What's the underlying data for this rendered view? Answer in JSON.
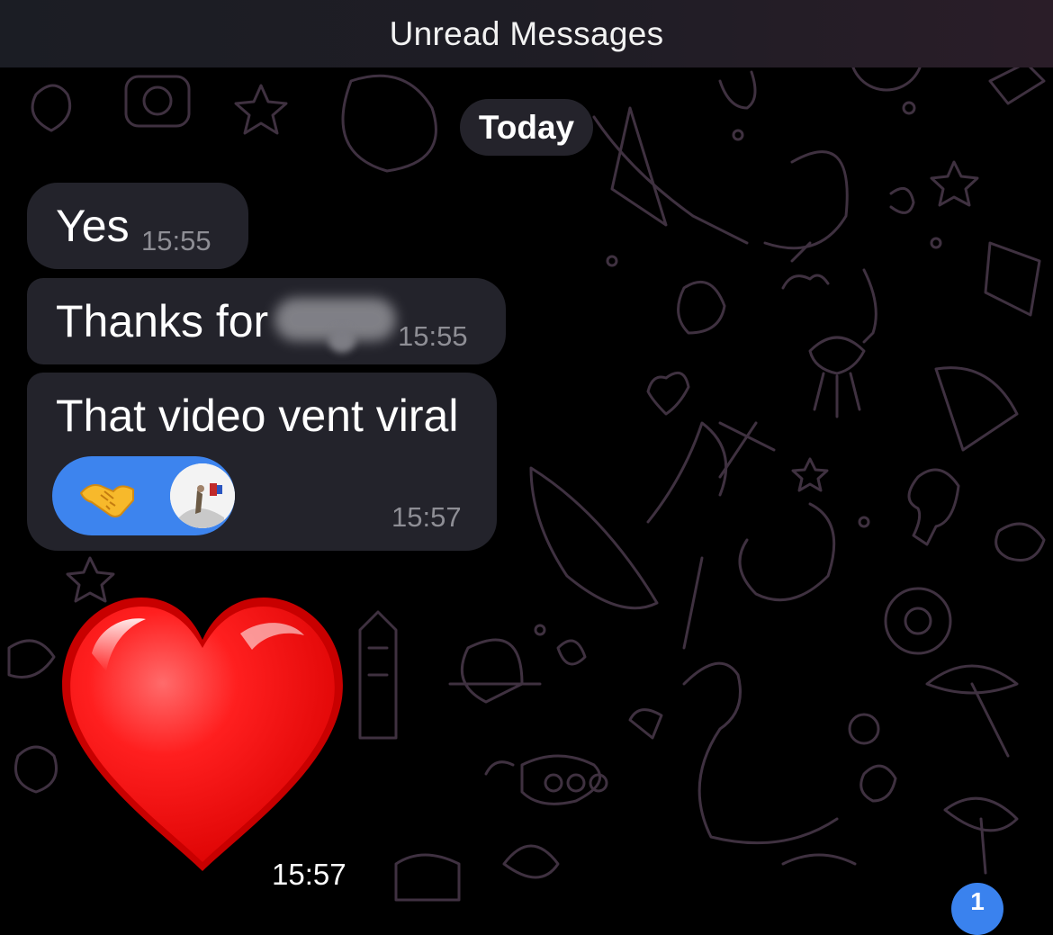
{
  "header": {
    "title": "Unread Messages"
  },
  "chat": {
    "date_separator": "Today",
    "messages": [
      {
        "text": "Yes",
        "time": "15:55"
      },
      {
        "text": "Thanks for ",
        "time": "15:55",
        "redacted": true
      },
      {
        "text": "That video vent viral",
        "time": "15:57",
        "reaction": {
          "emoji": "handshake-icon",
          "color": "#3d84ee"
        }
      },
      {
        "emoji": "red-heart-icon",
        "time": "15:57"
      }
    ],
    "unread_badge": "1"
  },
  "colors": {
    "background": "#000000",
    "bubble": "#23232b",
    "reaction": "#3d84ee",
    "heart": "#ff1a1a"
  }
}
